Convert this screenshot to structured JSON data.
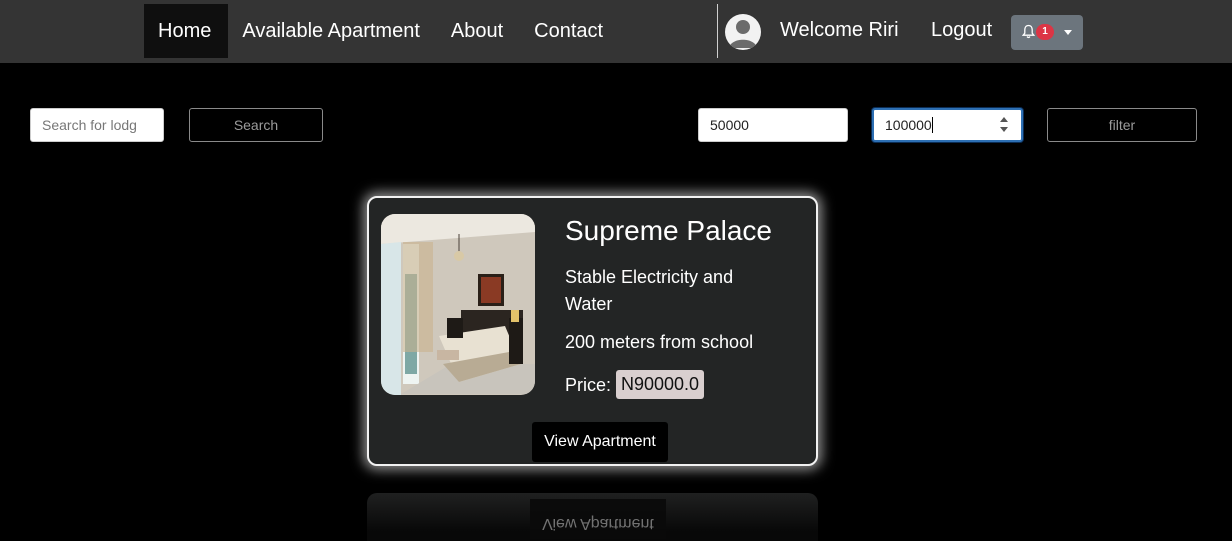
{
  "nav": {
    "items": [
      {
        "label": "Home",
        "active": true
      },
      {
        "label": "Available Apartment",
        "active": false
      },
      {
        "label": "About",
        "active": false
      },
      {
        "label": "Contact",
        "active": false
      }
    ],
    "user_icon": "user-avatar-icon",
    "welcome": "Welcome Riri",
    "logout": "Logout",
    "notifications": {
      "icon": "bell-icon",
      "count": "1",
      "caret_icon": "caret-down-icon"
    }
  },
  "search": {
    "placeholder": "Search for lodg",
    "button": "Search"
  },
  "filter": {
    "min_price": "50000",
    "max_price": "100000",
    "button": "filter"
  },
  "listing": {
    "title": "Supreme Palace",
    "feature": "Stable Electricity and Water",
    "distance": "200 meters from school",
    "price_label": "Price:",
    "price": "N90000.0",
    "view_button": "View Apartment",
    "image": "bedroom-photo"
  },
  "reflection": {
    "view_button": "View Apartment"
  },
  "colors": {
    "navbar": "#343434",
    "page_bg": "#000000",
    "card_bg": "#232525",
    "badge": "#dc3545",
    "notification_button": "#6c757d",
    "price_highlight": "#d9cfcf"
  }
}
